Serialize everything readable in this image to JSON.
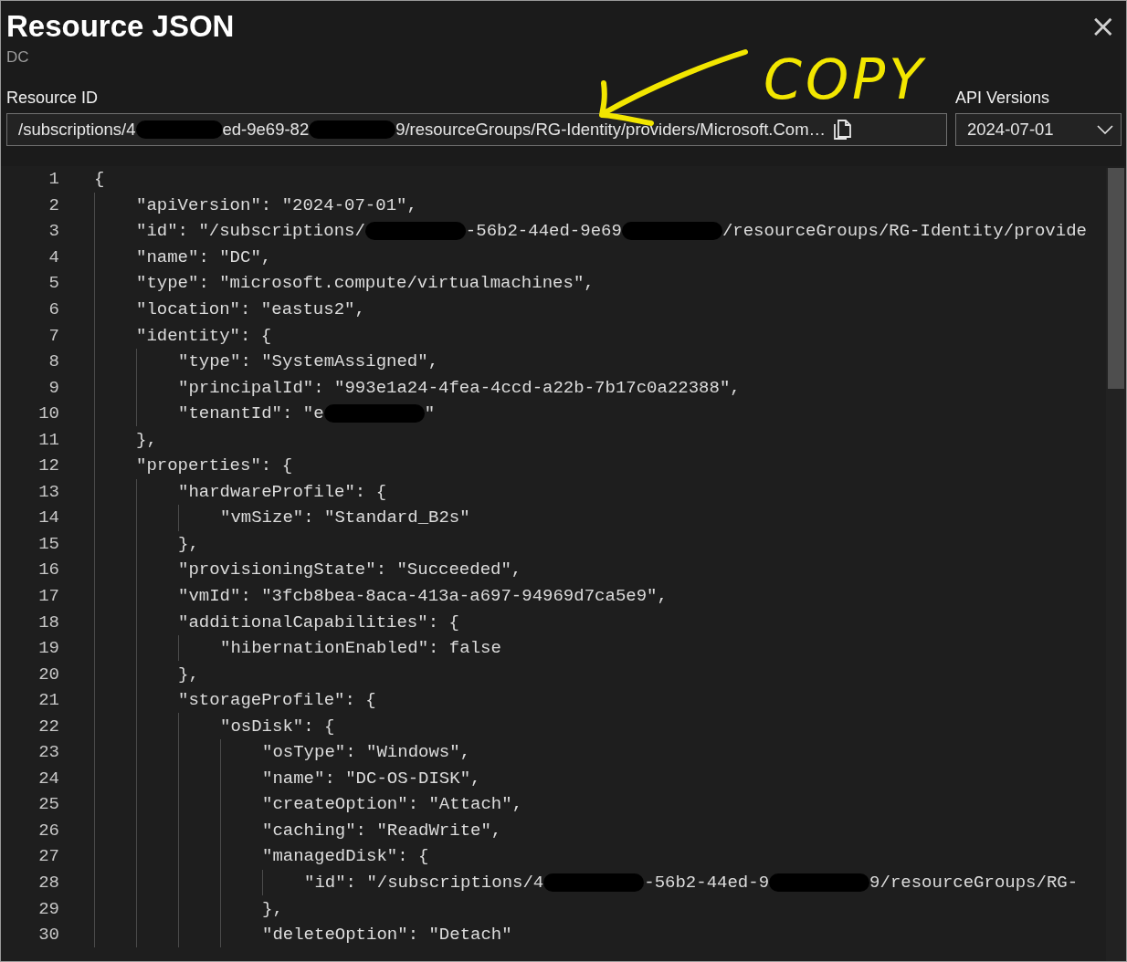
{
  "panel": {
    "title": "Resource JSON",
    "subtitle": "DC",
    "close": "×"
  },
  "annotation": {
    "text": "COPY"
  },
  "resource_id": {
    "label": "Resource ID",
    "segments": [
      "/subscriptions/4",
      "ed-9e69-82",
      "9/resourceGroups/RG-Identity/providers/Microsoft.Com…"
    ]
  },
  "api_versions": {
    "label": "API Versions",
    "value": "2024-07-01"
  },
  "editor": {
    "lines": [
      {
        "n": "1",
        "segments": [
          "{"
        ],
        "children": [
          {
            "n": "2",
            "segments": [
              "\"apiVersion\": \"2024-07-01\","
            ]
          },
          {
            "n": "3",
            "segments": [
              "\"id\": \"/subscriptions/",
              "-56b2-44ed-9e69",
              "/resourceGroups/RG-Identity/provide"
            ]
          },
          {
            "n": "4",
            "segments": [
              "\"name\": \"DC\","
            ]
          },
          {
            "n": "5",
            "segments": [
              "\"type\": \"microsoft.compute/virtualmachines\","
            ]
          },
          {
            "n": "6",
            "segments": [
              "\"location\": \"eastus2\","
            ]
          },
          {
            "n": "7",
            "segments": [
              "\"identity\": {"
            ],
            "children": [
              {
                "n": "8",
                "segments": [
                  "\"type\": \"SystemAssigned\","
                ]
              },
              {
                "n": "9",
                "segments": [
                  "\"principalId\": \"993e1a24-4fea-4ccd-a22b-7b17c0a22388\","
                ]
              },
              {
                "n": "10",
                "segments": [
                  "\"tenantId\": \"e",
                  "\""
                ]
              }
            ]
          },
          {
            "n": "11",
            "segments": [
              "},"
            ]
          },
          {
            "n": "12",
            "segments": [
              "\"properties\": {"
            ],
            "children": [
              {
                "n": "13",
                "segments": [
                  "\"hardwareProfile\": {"
                ],
                "children": [
                  {
                    "n": "14",
                    "segments": [
                      "\"vmSize\": \"Standard_B2s\""
                    ]
                  }
                ]
              },
              {
                "n": "15",
                "segments": [
                  "},"
                ]
              },
              {
                "n": "16",
                "segments": [
                  "\"provisioningState\": \"Succeeded\","
                ]
              },
              {
                "n": "17",
                "segments": [
                  "\"vmId\": \"3fcb8bea-8aca-413a-a697-94969d7ca5e9\","
                ]
              },
              {
                "n": "18",
                "segments": [
                  "\"additionalCapabilities\": {"
                ],
                "children": [
                  {
                    "n": "19",
                    "segments": [
                      "\"hibernationEnabled\": false"
                    ]
                  }
                ]
              },
              {
                "n": "20",
                "segments": [
                  "},"
                ]
              },
              {
                "n": "21",
                "segments": [
                  "\"storageProfile\": {"
                ],
                "children": [
                  {
                    "n": "22",
                    "segments": [
                      "\"osDisk\": {"
                    ],
                    "children": [
                      {
                        "n": "23",
                        "segments": [
                          "\"osType\": \"Windows\","
                        ]
                      },
                      {
                        "n": "24",
                        "segments": [
                          "\"name\": \"DC-OS-DISK\","
                        ]
                      },
                      {
                        "n": "25",
                        "segments": [
                          "\"createOption\": \"Attach\","
                        ]
                      },
                      {
                        "n": "26",
                        "segments": [
                          "\"caching\": \"ReadWrite\","
                        ]
                      },
                      {
                        "n": "27",
                        "segments": [
                          "\"managedDisk\": {"
                        ],
                        "children": [
                          {
                            "n": "28",
                            "segments": [
                              "\"id\": \"/subscriptions/4",
                              "-56b2-44ed-9",
                              "9/resourceGroups/RG-"
                            ]
                          }
                        ]
                      },
                      {
                        "n": "29",
                        "segments": [
                          "},"
                        ]
                      },
                      {
                        "n": "30",
                        "segments": [
                          "\"deleteOption\": \"Detach\""
                        ]
                      }
                    ]
                  }
                ]
              }
            ]
          }
        ]
      }
    ]
  }
}
